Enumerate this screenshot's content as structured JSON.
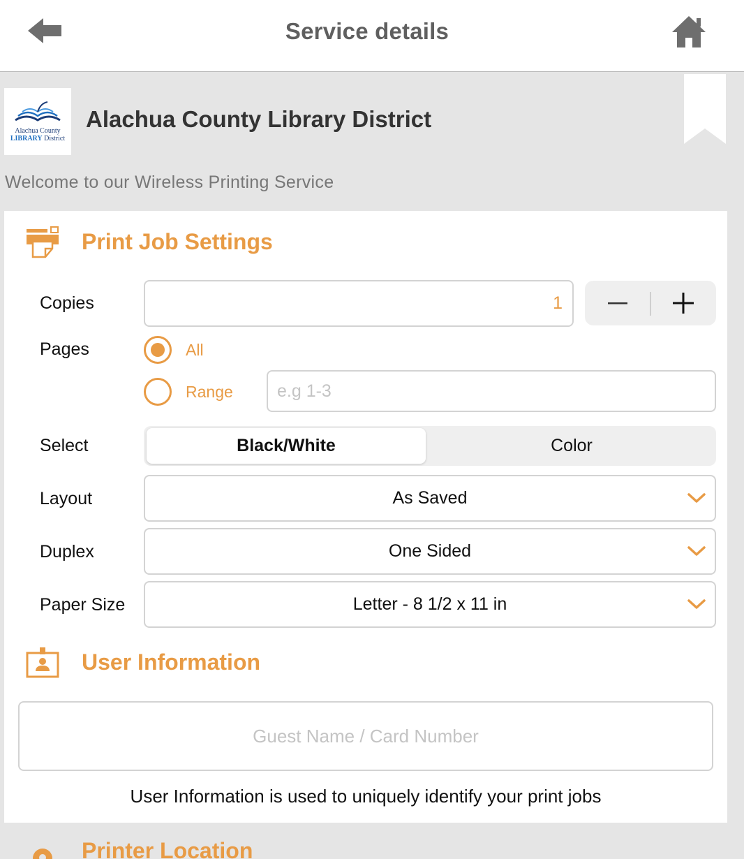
{
  "header": {
    "title": "Service details",
    "back_icon": "arrow-left-icon",
    "home_icon": "home-icon"
  },
  "library": {
    "logo_line1": "Alachua County",
    "logo_line2_a": "LIBRARY",
    "logo_line2_b": "District",
    "name": "Alachua County Library District",
    "welcome": "Welcome to our Wireless Printing Service",
    "bookmark_icon": "bookmark-icon"
  },
  "print_settings": {
    "title": "Print Job Settings",
    "icon": "printer-icon",
    "copies": {
      "label": "Copies",
      "value": "1"
    },
    "pages": {
      "label": "Pages",
      "all_label": "All",
      "range_label": "Range",
      "range_placeholder": "e.g 1-3",
      "selected": "All"
    },
    "select": {
      "label": "Select",
      "options": [
        "Black/White",
        "Color"
      ],
      "selected": "Black/White"
    },
    "layout": {
      "label": "Layout",
      "value": "As Saved"
    },
    "duplex": {
      "label": "Duplex",
      "value": "One Sided"
    },
    "paper_size": {
      "label": "Paper Size",
      "value": "Letter - 8 1/2 x 11 in"
    }
  },
  "user_info": {
    "title": "User Information",
    "icon": "id-badge-icon",
    "placeholder": "Guest Name / Card Number",
    "note": "User Information is used to uniquely identify your print jobs"
  },
  "printer_location": {
    "title": "Printer Location",
    "icon": "location-pin-icon"
  },
  "colors": {
    "accent": "#e89b45",
    "header_text": "#5f5f5f",
    "background": "#e5e5e5",
    "panel": "#ffffff"
  }
}
